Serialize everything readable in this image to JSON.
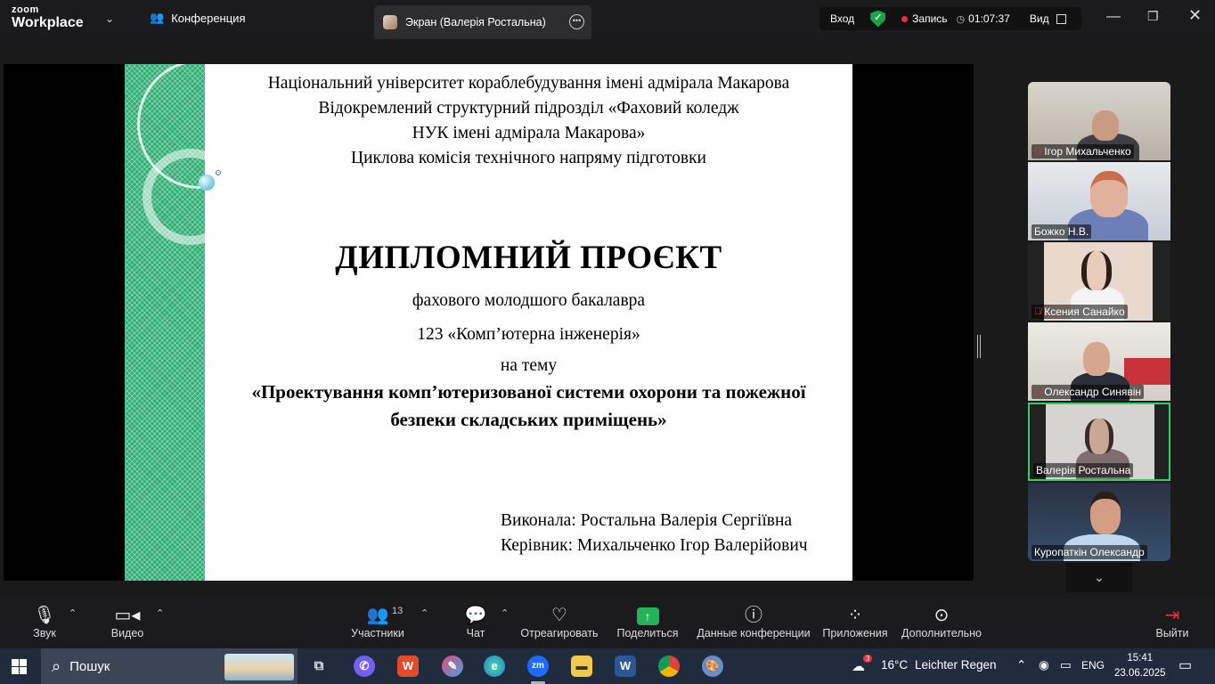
{
  "titlebar": {
    "logo_top": "zoom",
    "logo_bottom": "Workplace",
    "conference_tab": "Конференция",
    "screen_tab": "Экран (Валерія Ростальна)",
    "login": "Вход",
    "record_label": "Запись",
    "timer": "01:07:37",
    "view_label": "Вид"
  },
  "slide": {
    "line1": "Національний університет кораблебудування імені адмірала Макарова",
    "line2": "Відокремлений структурний підрозділ «Фаховий коледж",
    "line3": "НУК імені адмірала Макарова»",
    "line4": "Циклова комісія  технічного напряму підготовки",
    "title": "ДИПЛОМНИЙ ПРОЄКТ",
    "sub1": "фахового  молодшого бакалавра",
    "sub2": "123 «Комп’ютерна інженерія»",
    "sub3": "на тему",
    "topic1": "«Проектування комп’ютеризованої системи охорони та пожежної",
    "topic2": "безпеки складських приміщень»",
    "author": "Виконала: Ростальна Валерія Сергіївна",
    "supervisor": "Керівник: Михальченко Ігор Валерійович"
  },
  "participants": [
    {
      "name": "Ігор Михальченко",
      "muted": true
    },
    {
      "name": "Божко Н.В.",
      "muted": false
    },
    {
      "name": "Ксения Санайко",
      "muted": true
    },
    {
      "name": "Олександр Синявін",
      "muted": true
    },
    {
      "name": "Валерія Ростальна",
      "muted": false,
      "active": true
    },
    {
      "name": "Куропаткін Олександр",
      "muted": false
    }
  ],
  "toolbar": {
    "audio": "Звук",
    "video": "Видео",
    "participants": "Участники",
    "participants_count": "13",
    "chat": "Чат",
    "react": "Отреагировать",
    "share": "Поделиться",
    "info": "Данные конференции",
    "apps": "Приложения",
    "more": "Дополнительно",
    "leave": "Выйти"
  },
  "taskbar": {
    "search_placeholder": "Пошук",
    "weather_temp": "16°C",
    "weather_text": "Leichter Regen",
    "weather_badge": "3",
    "lang": "ENG",
    "time": "15:41",
    "date": "23.06.2025"
  },
  "colors": {
    "accent_green": "#22b35b",
    "record_red": "#e5323e",
    "active_border": "#2fd06a",
    "slide_stripe": "#2fae74"
  }
}
